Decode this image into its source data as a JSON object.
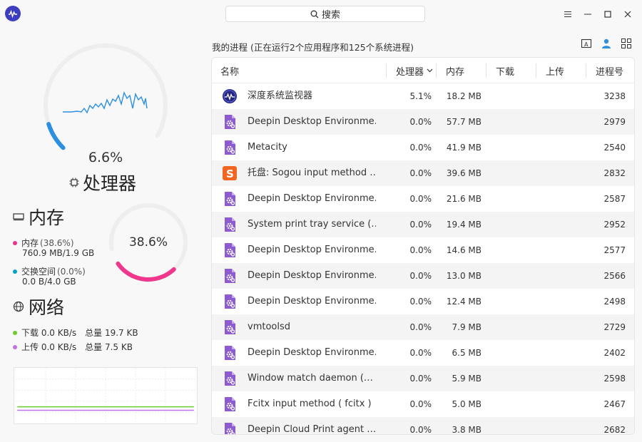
{
  "search": {
    "label": "搜索"
  },
  "cpu": {
    "percent": "6.6%",
    "fraction": 0.066,
    "title": "处理器"
  },
  "memory": {
    "title": "内存",
    "percent": "38.6%",
    "fraction": 0.386,
    "mem_label": "内存",
    "mem_paren": "(38.6%)",
    "mem_detail": "760.9 MB/1.9 GB",
    "swap_label": "交换空间",
    "swap_paren": "(0.0%)",
    "swap_detail": "0.0 B/4.0 GB",
    "mem_color": "#e8338b",
    "swap_color": "#00a5c4"
  },
  "network": {
    "title": "网络",
    "download": "下载 0.0 KB/s",
    "download_total": "总量 19.7 KB",
    "upload": "上传 0.0 KB/s",
    "upload_total": "总量 7.5 KB",
    "download_color": "#6ccc2a",
    "upload_color": "#c070e8"
  },
  "processes": {
    "summary": "我的进程 (正在运行2个应用程序和125个系统进程)",
    "columns": {
      "name": "名称",
      "cpu": "处理器",
      "mem": "内存",
      "download": "下载",
      "upload": "上传",
      "pid": "进程号"
    },
    "rows": [
      {
        "icon": "monitor",
        "name": "深度系统监视器",
        "cpu": "5.1%",
        "mem": "18.2 MB",
        "pid": "3238"
      },
      {
        "icon": "gear",
        "name": "Deepin Desktop Environme…",
        "cpu": "0.0%",
        "mem": "57.7 MB",
        "pid": "2979"
      },
      {
        "icon": "gear",
        "name": "Metacity",
        "cpu": "0.0%",
        "mem": "41.9 MB",
        "pid": "2540"
      },
      {
        "icon": "sogou",
        "name": "托盘: Sogou input method  …",
        "cpu": "0.0%",
        "mem": "39.6 MB",
        "pid": "2832"
      },
      {
        "icon": "gear",
        "name": "Deepin Desktop Environme…",
        "cpu": "0.0%",
        "mem": "21.6 MB",
        "pid": "2587"
      },
      {
        "icon": "gear",
        "name": "System print tray service  (…",
        "cpu": "0.0%",
        "mem": "19.4 MB",
        "pid": "2952"
      },
      {
        "icon": "gear",
        "name": "Deepin Desktop Environme…",
        "cpu": "0.0%",
        "mem": "14.6 MB",
        "pid": "2577"
      },
      {
        "icon": "gear",
        "name": "Deepin Desktop Environme…",
        "cpu": "0.0%",
        "mem": "13.0 MB",
        "pid": "2566"
      },
      {
        "icon": "gear",
        "name": "Deepin Desktop Environme…",
        "cpu": "0.0%",
        "mem": "12.4 MB",
        "pid": "2498"
      },
      {
        "icon": "gear",
        "name": "vmtoolsd",
        "cpu": "0.0%",
        "mem": "7.9 MB",
        "pid": "2729"
      },
      {
        "icon": "gear",
        "name": "Deepin Desktop Environme…",
        "cpu": "0.0%",
        "mem": "6.5 MB",
        "pid": "2402"
      },
      {
        "icon": "gear",
        "name": "Window match daemon  (…",
        "cpu": "0.0%",
        "mem": "5.9 MB",
        "pid": "2598"
      },
      {
        "icon": "gear",
        "name": "Fcitx input method  ( fcitx )",
        "cpu": "0.0%",
        "mem": "5.0 MB",
        "pid": "2467"
      },
      {
        "icon": "gear",
        "name": "Deepin Cloud Print agent  …",
        "cpu": "0.0%",
        "mem": "3.8 MB",
        "pid": "2682"
      }
    ]
  },
  "colors": {
    "accent": "#2c8fe0",
    "cpu_ring": "#2c8fe0",
    "mem_ring": "#f0378e",
    "ring_track": "#eeeeee",
    "app_purple": "#8c5bd0"
  }
}
